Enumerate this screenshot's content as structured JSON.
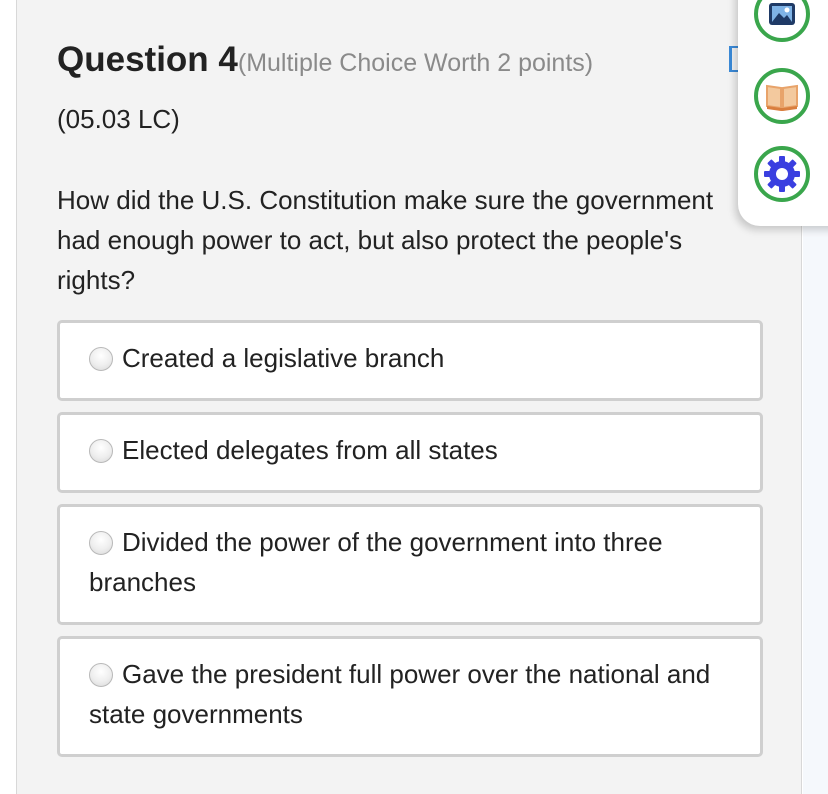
{
  "question": {
    "title": "Question 4",
    "meta": "(Multiple Choice Worth 2 points)",
    "code": "(05.03 LC)",
    "text": "How did the U.S. Constitution make sure the government had enough power to act, but also protect the people's rights?"
  },
  "options": [
    {
      "label": "Created a legislative branch",
      "selected": false
    },
    {
      "label": "Elected delegates from all states",
      "selected": false
    },
    {
      "label": "Divided the power of the government into three branches",
      "selected": false
    },
    {
      "label": "Gave the president full power over the national and state governments",
      "selected": false
    }
  ],
  "tools": [
    {
      "icon": "image-icon"
    },
    {
      "icon": "book-icon"
    },
    {
      "icon": "gear-icon"
    }
  ],
  "colors": {
    "card_bg": "#f3f3f3",
    "meta_gray": "#8a8a8a",
    "tool_ring": "#3aa64c",
    "gear_blue": "#3a3fe0",
    "book_orange": "#e8a36a",
    "bookmark_blue": "#3b8ad8"
  }
}
